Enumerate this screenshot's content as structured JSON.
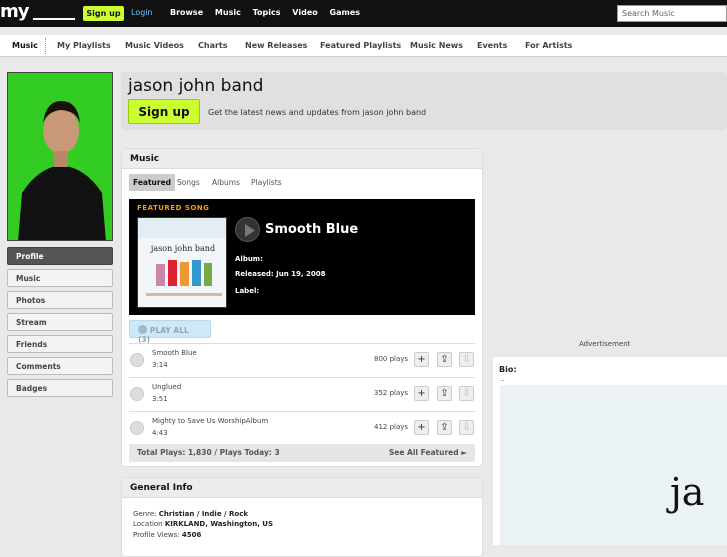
{
  "topbar": {
    "logo": "my",
    "signup": "Sign up",
    "login": "Login",
    "nav": [
      "Browse",
      "Music",
      "Topics",
      "Video",
      "Games"
    ],
    "search_placeholder": "Search Music"
  },
  "subnav": [
    "Music",
    "My Playlists",
    "Music Videos",
    "Charts",
    "New Releases",
    "Featured Playlists",
    "Music News",
    "Events",
    "For Artists"
  ],
  "sidebar": [
    "Profile",
    "Music",
    "Photos",
    "Stream",
    "Friends",
    "Comments",
    "Badges"
  ],
  "header": {
    "band_name": "jason john band",
    "signup": "Sign up",
    "subtitle": "Get the latest news and updates from jason john band"
  },
  "music": {
    "title": "Music",
    "tabs": [
      "Featured",
      "Songs",
      "Albums",
      "Playlists"
    ],
    "featured_label": "FEATURED SONG",
    "album_art_text": "jason john band",
    "song_title": "Smooth Blue",
    "album_label": "Album:",
    "released_label": "Released: Jun 19, 2008",
    "label_label": "Label:",
    "play_all": "PLAY ALL (3)",
    "tracks": [
      {
        "name": "Smooth Blue",
        "time": "3:14",
        "plays": "800 plays"
      },
      {
        "name": "Unglued",
        "time": "3:51",
        "plays": "352 plays"
      },
      {
        "name": "Mighty to Save Us WorshipAlbum",
        "time": "4:43",
        "plays": "412 plays"
      }
    ],
    "totals": "Total Plays: 1,830 / Plays Today: 3",
    "see_all": "See All Featured ►"
  },
  "general_info": {
    "title": "General Info",
    "genre_label": "Genre:",
    "genre": "Christian / Indie / Rock",
    "location_label": "Location",
    "location": "KIRKLAND, Washington, US",
    "views_label": "Profile Views:",
    "views": "4506"
  },
  "right": {
    "ad_label": "Advertisement",
    "bio_label": "Bio:",
    "bio_text": "..",
    "bio_image_text": "ja"
  },
  "colors": {
    "accent": "#ccff33",
    "topbar": "#111111",
    "featured": "#ff9900",
    "link": "#66ccff"
  }
}
